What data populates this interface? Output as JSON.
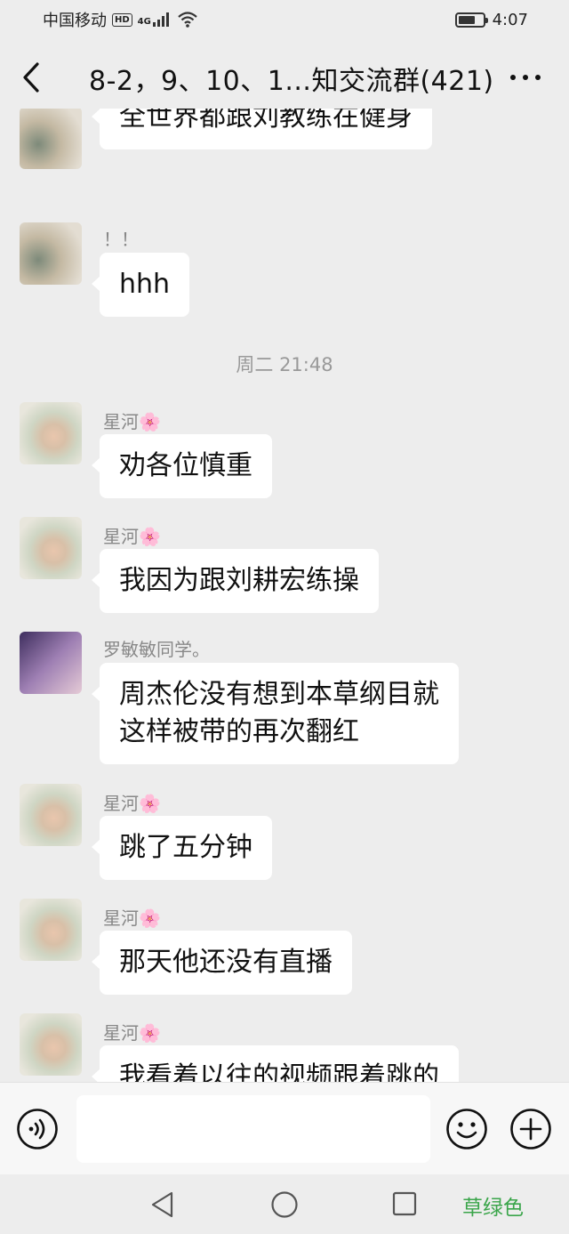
{
  "status_bar": {
    "carrier": "中国移动",
    "hd_badge": "HD",
    "network": "4G",
    "time": "4:07",
    "battery_level": 0.7
  },
  "header": {
    "title": "8-2，9、10、1...知交流群(421)"
  },
  "messages": [
    {
      "sender": "！！",
      "text": "全世界都跟刘教练在健身",
      "avatar": "girl-photo"
    },
    {
      "sender": "！！",
      "text": "hhh",
      "avatar": "girl-photo"
    },
    {
      "timestamp": "周二 21:48"
    },
    {
      "sender": "星河🌸",
      "text": "劝各位慎重",
      "avatar": "flower-bouquet"
    },
    {
      "sender": "星河🌸",
      "text": "我因为跟刘耕宏练操",
      "avatar": "flower-bouquet"
    },
    {
      "sender": "罗敏敏同学。",
      "text_line1": "周杰伦没有想到本草纲目就",
      "text_line2": "这样被带的再次翻红",
      "avatar": "anime-girl"
    },
    {
      "sender": "星河🌸",
      "text": "跳了五分钟",
      "avatar": "flower-bouquet"
    },
    {
      "sender": "星河🌸",
      "text": "那天他还没有直播",
      "avatar": "flower-bouquet"
    },
    {
      "sender": "星河🌸",
      "text": "我看着以往的视频跟着跳的",
      "avatar": "flower-bouquet"
    }
  ],
  "input_bar": {
    "placeholder": ""
  },
  "system_nav": {
    "brand": "草绿色"
  },
  "colors": {
    "background": "#ededed",
    "bubble": "#ffffff",
    "brand_green": "#3aa54a"
  }
}
